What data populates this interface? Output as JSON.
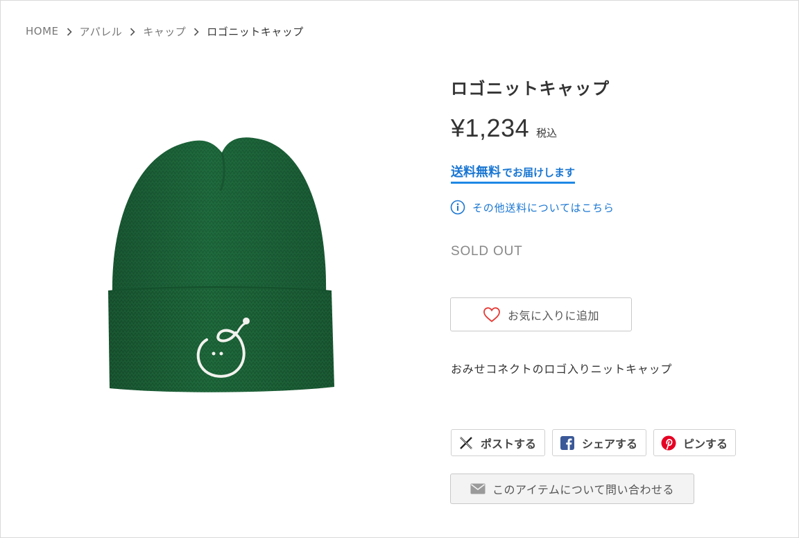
{
  "breadcrumb": {
    "items": [
      {
        "label": "HOME"
      },
      {
        "label": "アパレル"
      },
      {
        "label": "キャップ"
      },
      {
        "label": "ロゴニットキャップ"
      }
    ]
  },
  "product": {
    "title": "ロゴニットキャップ",
    "price": "¥1,234",
    "tax_label": "税込",
    "shipping_free": "送料無料",
    "shipping_rest": "でお届けします",
    "shipping_info_link": "その他送料についてはこちら",
    "status": "SOLD OUT",
    "favorite_label": "お気に入りに追加",
    "description": "おみせコネクトのロゴ入りニットキャップ",
    "image": {
      "subject": "green knit beanie with white embroidered smiley logo",
      "knit_color": "#1f6b3e",
      "logo_color": "#f2f2ee"
    }
  },
  "share": {
    "x_label": "ポストする",
    "facebook_label": "シェアする",
    "pinterest_label": "ピンする"
  },
  "contact": {
    "label": "このアイテムについて問い合わせる"
  },
  "colors": {
    "accent_blue": "#1976d2",
    "heart_red": "#e53935",
    "facebook": "#3b5998",
    "pinterest": "#e60023"
  },
  "icons": [
    "chevron-right-icon",
    "info-icon",
    "heart-icon",
    "x-logo-icon",
    "facebook-icon",
    "pinterest-icon",
    "mail-icon"
  ]
}
